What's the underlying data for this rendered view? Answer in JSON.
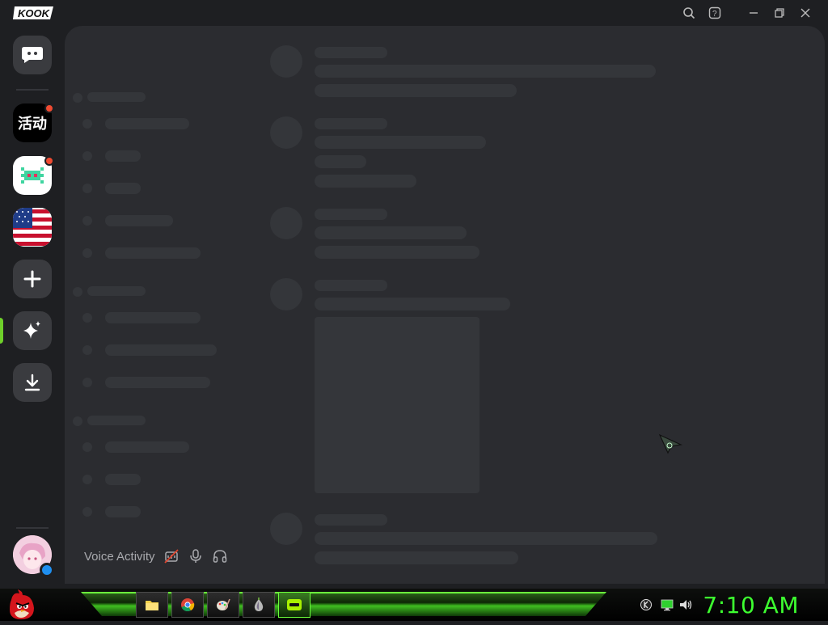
{
  "app": {
    "name": "KOOK"
  },
  "window_controls": [
    "search-icon",
    "help-icon",
    "minimize-icon",
    "restore-icon",
    "close-icon"
  ],
  "servers": [
    {
      "name": "home-dm",
      "icon": "chat-bubble-icon"
    },
    {
      "name": "activities",
      "label": "活动",
      "badge": true
    },
    {
      "name": "pixel-server",
      "badge": true
    },
    {
      "name": "us-flag-server"
    },
    {
      "name": "add-server",
      "icon": "plus-icon"
    },
    {
      "name": "discover",
      "icon": "sparkle-icon",
      "active": true
    },
    {
      "name": "download",
      "icon": "download-icon"
    }
  ],
  "user_panel": {
    "voice_label": "Voice Activity",
    "icons": [
      "voice-off-icon",
      "microphone-icon",
      "headphones-icon"
    ]
  },
  "taskbar": {
    "start": "angry-bird-start-icon",
    "apps": [
      "file-explorer-icon",
      "chrome-icon",
      "paint-icon",
      "onion-browser-icon",
      "kook-app-icon"
    ],
    "tray": [
      "kook-tray-icon",
      "network-icon",
      "volume-icon"
    ],
    "clock": "7:10 AM"
  },
  "colors": {
    "accent": "#6ed02a",
    "badge": "#f04b32",
    "clock": "#3dff30"
  }
}
